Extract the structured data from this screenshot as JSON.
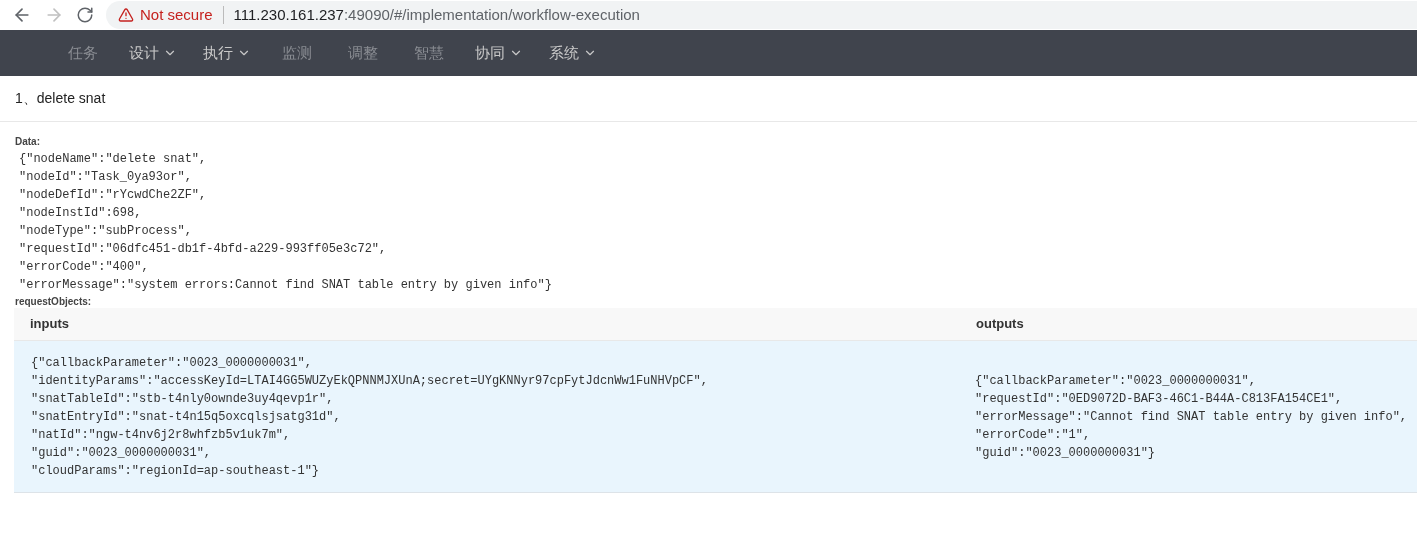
{
  "browser": {
    "security": "Not secure",
    "url_host": "111.230.161.237",
    "url_rest": ":49090/#/implementation/workflow-execution",
    "forward_disabled": true
  },
  "nav": [
    {
      "label": "任务",
      "has_menu": false
    },
    {
      "label": "设计",
      "has_menu": true
    },
    {
      "label": "执行",
      "has_menu": true
    },
    {
      "label": "监测",
      "has_menu": false
    },
    {
      "label": "调整",
      "has_menu": false
    },
    {
      "label": "智慧",
      "has_menu": false
    },
    {
      "label": "协同",
      "has_menu": true
    },
    {
      "label": "系统",
      "has_menu": true
    }
  ],
  "step_title": "1、delete snat",
  "data_label": "Data:",
  "data_lines": [
    "{\"nodeName\":\"delete snat\",",
    "\"nodeId\":\"Task_0ya93or\",",
    "\"nodeDefId\":\"rYcwdChe2ZF\",",
    "\"nodeInstId\":698,",
    "\"nodeType\":\"subProcess\",",
    "\"requestId\":\"06dfc451-db1f-4bfd-a229-993ff05e3c72\",",
    "\"errorCode\":\"400\",",
    "\"errorMessage\":\"system errors:Cannot find SNAT table entry by given info\"}"
  ],
  "request_label": "requestObjects:",
  "table": {
    "columns": [
      "inputs",
      "outputs"
    ],
    "rows": [
      {
        "inputs": [
          "{\"callbackParameter\":\"0023_0000000031\",",
          "\"identityParams\":\"accessKeyId=LTAI4GG5WUZyEkQPNNMJXUnA;secret=UYgKNNyr97cpFytJdcnWw1FuNHVpCF\",",
          "\"snatTableId\":\"stb-t4nly0ownde3uy4qevp1r\",",
          "\"snatEntryId\":\"snat-t4n15q5oxcqlsjsatg31d\",",
          "\"natId\":\"ngw-t4nv6j2r8whfzb5v1uk7m\",",
          "\"guid\":\"0023_0000000031\",",
          "\"cloudParams\":\"regionId=ap-southeast-1\"}"
        ],
        "outputs": [
          "{\"callbackParameter\":\"0023_0000000031\",",
          "\"requestId\":\"0ED9072D-BAF3-46C1-B44A-C813FA154CE1\",",
          "\"errorMessage\":\"Cannot find SNAT table entry by given info\",",
          "\"errorCode\":\"1\",",
          "\"guid\":\"0023_0000000031\"}"
        ]
      }
    ]
  }
}
